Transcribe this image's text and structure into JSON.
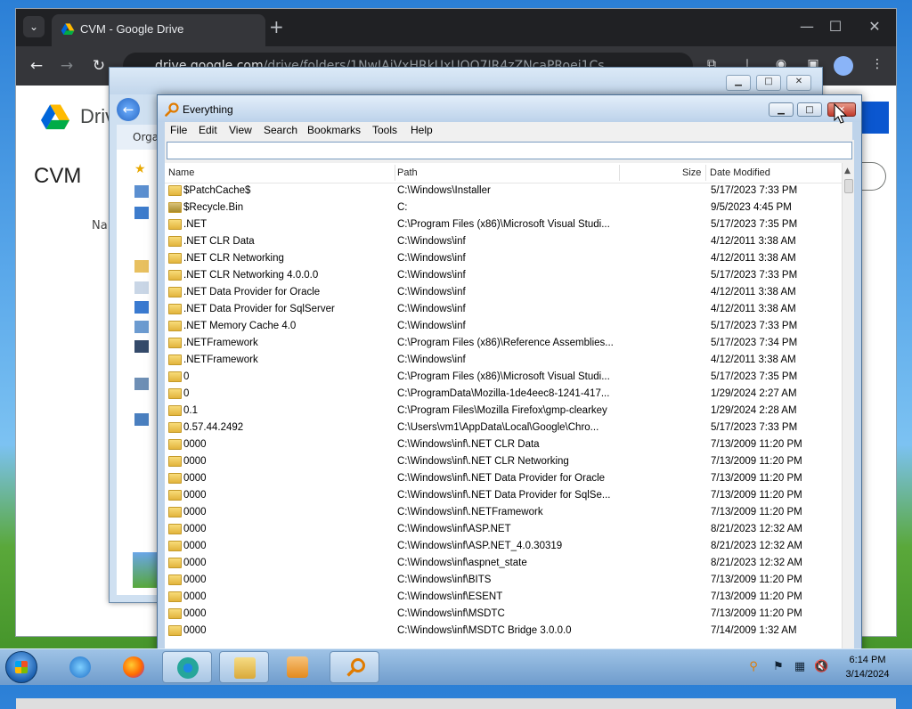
{
  "chrome": {
    "tab_title": "CVM - Google Drive",
    "new_tab": "+",
    "url_host": "drive.google.com",
    "url_path": "/drive/folders/1NwIAiVxHRkUxUQO7JR4zZNcaPRoei1Cs",
    "drive_label": "Drive",
    "folder_title": "CVM",
    "name_column_partial": "Na"
  },
  "explorer": {
    "organize_partial": "Orga",
    "min": "▁",
    "max": "□",
    "close": "✕"
  },
  "everything": {
    "title": "Everything",
    "menu": [
      "File",
      "Edit",
      "View",
      "Search",
      "Bookmarks",
      "Tools",
      "Help"
    ],
    "search_value": "",
    "columns": {
      "name": "Name",
      "path": "Path",
      "size": "Size",
      "date": "Date Modified"
    },
    "rows": [
      {
        "name": "$PatchCache$",
        "path": "C:\\Windows\\Installer",
        "date": "5/17/2023 7:33 PM"
      },
      {
        "name": "$Recycle.Bin",
        "path": "C:",
        "date": "9/5/2023 4:45 PM"
      },
      {
        "name": ".NET",
        "path": "C:\\Program Files (x86)\\Microsoft Visual Studi...",
        "date": "5/17/2023 7:35 PM"
      },
      {
        "name": ".NET CLR Data",
        "path": "C:\\Windows\\inf",
        "date": "4/12/2011 3:38 AM"
      },
      {
        "name": ".NET CLR Networking",
        "path": "C:\\Windows\\inf",
        "date": "4/12/2011 3:38 AM"
      },
      {
        "name": ".NET CLR Networking 4.0.0.0",
        "path": "C:\\Windows\\inf",
        "date": "5/17/2023 7:33 PM"
      },
      {
        "name": ".NET Data Provider for Oracle",
        "path": "C:\\Windows\\inf",
        "date": "4/12/2011 3:38 AM"
      },
      {
        "name": ".NET Data Provider for SqlServer",
        "path": "C:\\Windows\\inf",
        "date": "4/12/2011 3:38 AM"
      },
      {
        "name": ".NET Memory Cache 4.0",
        "path": "C:\\Windows\\inf",
        "date": "5/17/2023 7:33 PM"
      },
      {
        "name": ".NETFramework",
        "path": "C:\\Program Files (x86)\\Reference Assemblies...",
        "date": "5/17/2023 7:34 PM"
      },
      {
        "name": ".NETFramework",
        "path": "C:\\Windows\\inf",
        "date": "4/12/2011 3:38 AM"
      },
      {
        "name": "0",
        "path": "C:\\Program Files (x86)\\Microsoft Visual Studi...",
        "date": "5/17/2023 7:35 PM"
      },
      {
        "name": "0",
        "path": "C:\\ProgramData\\Mozilla-1de4eec8-1241-417...",
        "date": "1/29/2024 2:27 AM"
      },
      {
        "name": "0.1",
        "path": "C:\\Program Files\\Mozilla Firefox\\gmp-clearkey",
        "date": "1/29/2024 2:28 AM"
      },
      {
        "name": "0.57.44.2492",
        "path": "C:\\Users\\vm1\\AppData\\Local\\Google\\Chro...",
        "date": "5/17/2023 7:33 PM"
      },
      {
        "name": "0000",
        "path": "C:\\Windows\\inf\\.NET CLR Data",
        "date": "7/13/2009 11:20 PM"
      },
      {
        "name": "0000",
        "path": "C:\\Windows\\inf\\.NET CLR Networking",
        "date": "7/13/2009 11:20 PM"
      },
      {
        "name": "0000",
        "path": "C:\\Windows\\inf\\.NET Data Provider for Oracle",
        "date": "7/13/2009 11:20 PM"
      },
      {
        "name": "0000",
        "path": "C:\\Windows\\inf\\.NET Data Provider for SqlSe...",
        "date": "7/13/2009 11:20 PM"
      },
      {
        "name": "0000",
        "path": "C:\\Windows\\inf\\.NETFramework",
        "date": "7/13/2009 11:20 PM"
      },
      {
        "name": "0000",
        "path": "C:\\Windows\\inf\\ASP.NET",
        "date": "8/21/2023 12:32 AM"
      },
      {
        "name": "0000",
        "path": "C:\\Windows\\inf\\ASP.NET_4.0.30319",
        "date": "8/21/2023 12:32 AM"
      },
      {
        "name": "0000",
        "path": "C:\\Windows\\inf\\aspnet_state",
        "date": "8/21/2023 12:32 AM"
      },
      {
        "name": "0000",
        "path": "C:\\Windows\\inf\\BITS",
        "date": "7/13/2009 11:20 PM"
      },
      {
        "name": "0000",
        "path": "C:\\Windows\\inf\\ESENT",
        "date": "7/13/2009 11:20 PM"
      },
      {
        "name": "0000",
        "path": "C:\\Windows\\inf\\MSDTC",
        "date": "7/13/2009 11:20 PM"
      },
      {
        "name": "0000",
        "path": "C:\\Windows\\inf\\MSDTC Bridge 3.0.0.0",
        "date": "7/14/2009 1:32 AM"
      }
    ]
  },
  "taskbar": {
    "time": "6:14 PM",
    "date": "3/14/2024"
  },
  "colors": {
    "chrome_dark": "#202124",
    "drive_blue": "#0b57d0",
    "folder_yellow": "#e2b43c",
    "close_red": "#c0392b"
  }
}
